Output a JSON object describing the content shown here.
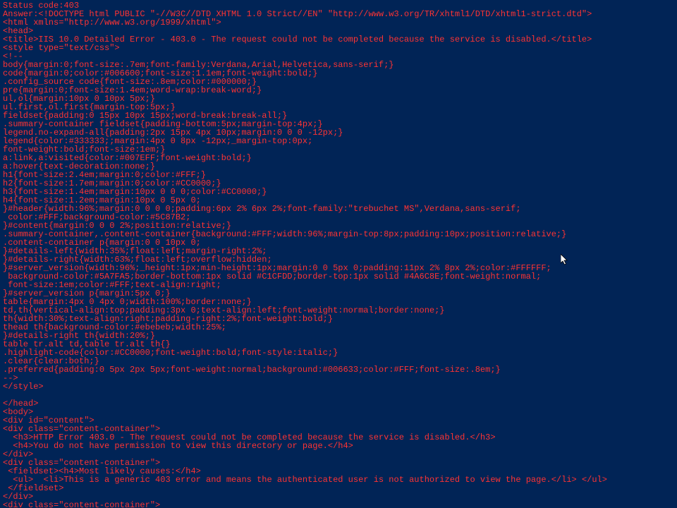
{
  "lines": [
    "Status code:403",
    "Answer:<!DOCTYPE html PUBLIC \"-//W3C//DTD XHTML 1.0 Strict//EN\" \"http://www.w3.org/TR/xhtml1/DTD/xhtml1-strict.dtd\">",
    "<html xmlns=\"http://www.w3.org/1999/xhtml\">",
    "<head>",
    "<title>IIS 10.0 Detailed Error - 403.0 - The request could not be completed because the service is disabled.</title>",
    "<style type=\"text/css\">",
    "<!--",
    "body{margin:0;font-size:.7em;font-family:Verdana,Arial,Helvetica,sans-serif;}",
    "code{margin:0;color:#006600;font-size:1.1em;font-weight:bold;}",
    ".config_source code{font-size:.8em;color:#000000;}",
    "pre{margin:0;font-size:1.4em;word-wrap:break-word;}",
    "ul,ol{margin:10px 0 10px 5px;}",
    "ul.first,ol.first{margin-top:5px;}",
    "fieldset{padding:0 15px 10px 15px;word-break:break-all;}",
    ".summary-container fieldset{padding-bottom:5px;margin-top:4px;}",
    "legend.no-expand-all{padding:2px 15px 4px 10px;margin:0 0 0 -12px;}",
    "legend{color:#333333;;margin:4px 0 8px -12px;_margin-top:0px;",
    "font-weight:bold;font-size:1em;}",
    "a:link,a:visited{color:#007EFF;font-weight:bold;}",
    "a:hover{text-decoration:none;}",
    "h1{font-size:2.4em;margin:0;color:#FFF;}",
    "h2{font-size:1.7em;margin:0;color:#CC0000;}",
    "h3{font-size:1.4em;margin:10px 0 0 0;color:#CC0000;}",
    "h4{font-size:1.2em;margin:10px 0 5px 0;",
    "}#header{width:96%;margin:0 0 0 0;padding:6px 2% 6px 2%;font-family:\"trebuchet MS\",Verdana,sans-serif;",
    " color:#FFF;background-color:#5C87B2;",
    "}#content{margin:0 0 0 2%;position:relative;}",
    ".summary-container,.content-container{background:#FFF;width:96%;margin-top:8px;padding:10px;position:relative;}",
    ".content-container p{margin:0 0 10px 0;",
    "}#details-left{width:35%;float:left;margin-right:2%;",
    "}#details-right{width:63%;float:left;overflow:hidden;",
    "}#server_version{width:96%;_height:1px;min-height:1px;margin:0 0 5px 0;padding:11px 2% 8px 2%;color:#FFFFFF;",
    " background-color:#5A7FA5;border-bottom:1px solid #C1CFDD;border-top:1px solid #4A6C8E;font-weight:normal;",
    " font-size:1em;color:#FFF;text-align:right;",
    "}#server_version p{margin:5px 0;}",
    "table{margin:4px 0 4px 0;width:100%;border:none;}",
    "td,th{vertical-align:top;padding:3px 0;text-align:left;font-weight:normal;border:none;}",
    "th{width:30%;text-align:right;padding-right:2%;font-weight:bold;}",
    "thead th{background-color:#ebebeb;width:25%;",
    "}#details-right th{width:20%;}",
    "table tr.alt td,table tr.alt th{}",
    ".highlight-code{color:#CC0000;font-weight:bold;font-style:italic;}",
    ".clear{clear:both;}",
    ".preferred{padding:0 5px 2px 5px;font-weight:normal;background:#006633;color:#FFF;font-size:.8em;}",
    "-->",
    "</style>",
    "",
    "</head>",
    "<body>",
    "<div id=\"content\">",
    "<div class=\"content-container\">",
    "  <h3>HTTP Error 403.0 - The request could not be completed because the service is disabled.</h3>",
    "  <h4>You do not have permission to view this directory or page.</h4>",
    "</div>",
    "<div class=\"content-container\">",
    " <fieldset><h4>Most likely causes:</h4>",
    "  <ul>  <li>This is a generic 403 error and means the authenticated user is not authorized to view the page.</li> </ul>",
    " </fieldset>",
    "</div>",
    "<div class=\"content-container\">"
  ]
}
